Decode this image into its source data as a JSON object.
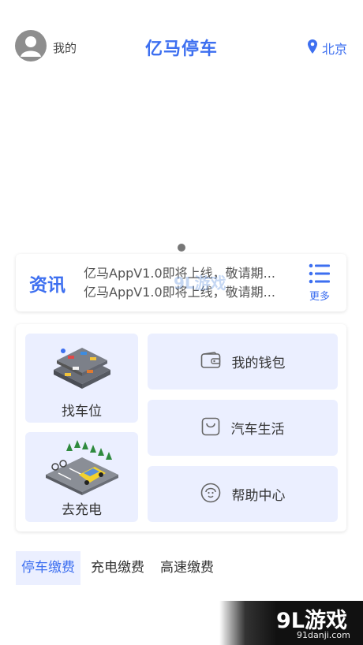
{
  "header": {
    "me_label": "我的",
    "title": "亿马停车",
    "location": "北京"
  },
  "news": {
    "logo": "资讯",
    "items": [
      "亿马AppV1.0即将上线，敬请期...",
      "亿马AppV1.0即将上线，敬请期..."
    ],
    "more_label": "更多"
  },
  "features": {
    "find_parking": "找车位",
    "charging": "去充电",
    "wallet": "我的钱包",
    "car_life": "汽车生活",
    "help": "帮助中心"
  },
  "tabs": [
    {
      "label": "停车缴费",
      "active": true
    },
    {
      "label": "充电缴费",
      "active": false
    },
    {
      "label": "高速缴费",
      "active": false
    }
  ],
  "watermarks": {
    "main": "9L游戏",
    "sub": "91danji.com",
    "middle": "9L游戏"
  },
  "colors": {
    "accent": "#3d6ff0",
    "tile_bg": "#ebefff"
  },
  "icons": [
    "user-avatar-icon",
    "location-pin-icon",
    "list-menu-icon",
    "wallet-icon",
    "bag-icon",
    "support-face-icon"
  ]
}
